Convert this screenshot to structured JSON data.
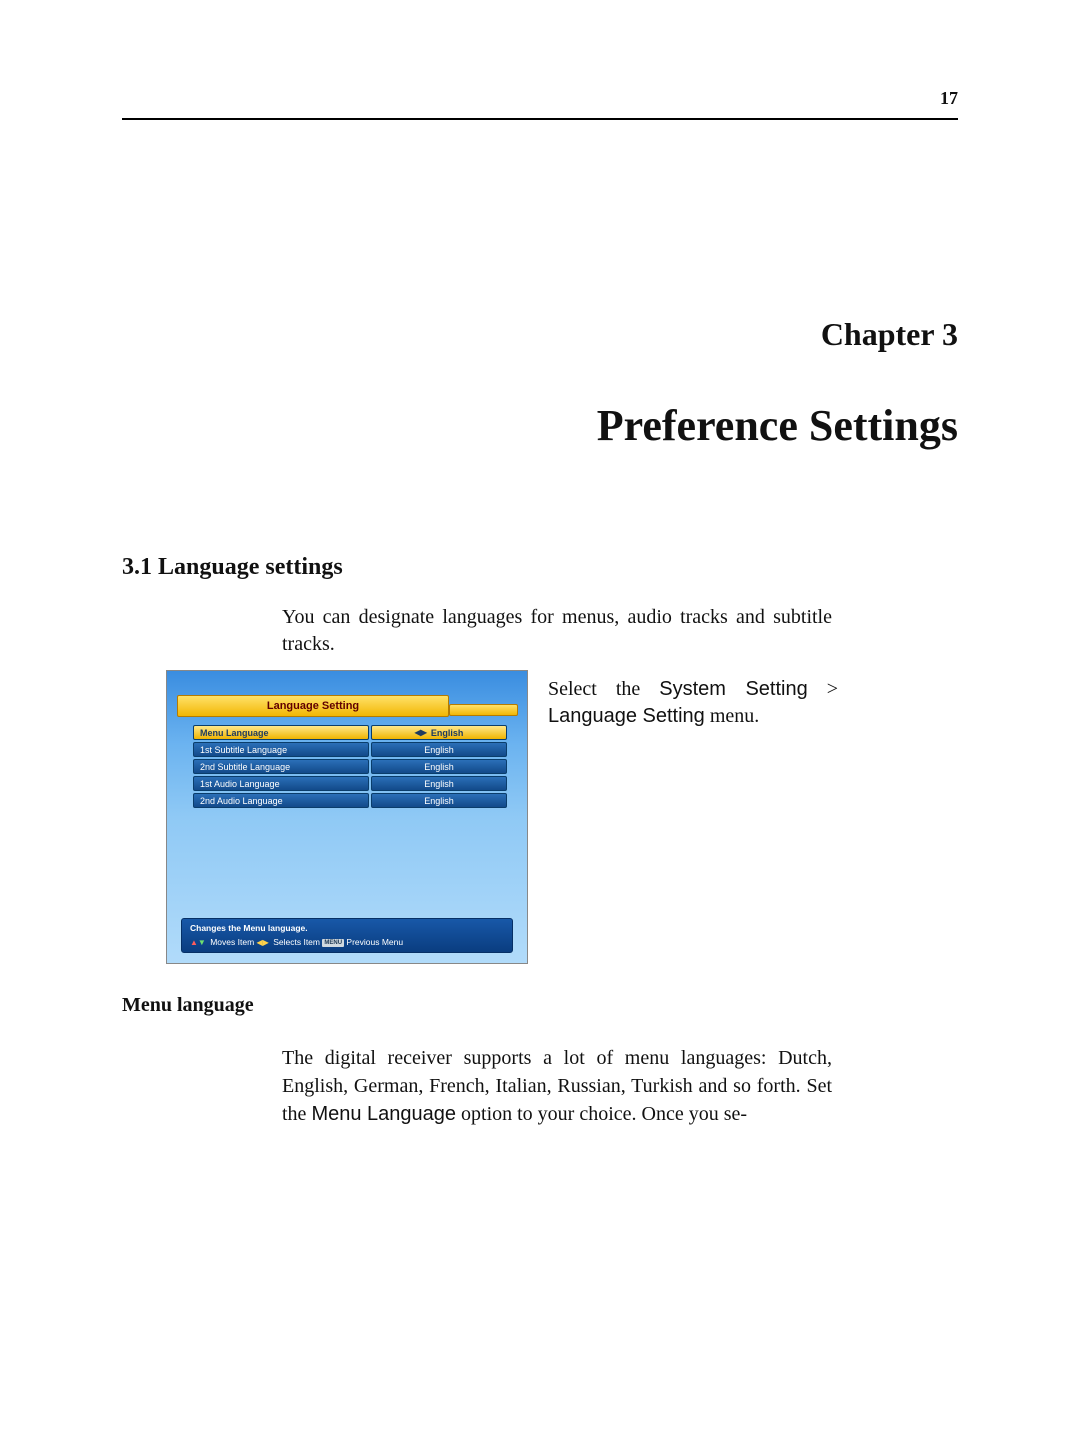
{
  "page_number": "17",
  "chapter_label": "Chapter 3",
  "chapter_title": "Preference Settings",
  "section": {
    "number": "3.1",
    "title": "Language settings",
    "heading_full": "3.1   Language settings"
  },
  "intro_paragraph": "You can designate languages for menus, audio tracks and subtitle tracks.",
  "side_text": {
    "pre": "Select  the ",
    "menu1": "System  Setting",
    "gt": " > ",
    "menu2": "Language Setting",
    "post": " menu."
  },
  "subheading": "Menu language",
  "body2": {
    "t1": "The digital receiver supports a lot of menu languages: Dutch, English, German, French, Italian, Russian, Turkish and so forth. Set the ",
    "opt": "Menu Language",
    "t2": " option to your choice.  Once you se-"
  },
  "device": {
    "title": "Language Setting",
    "rows": [
      {
        "label": "Menu Language",
        "value": "English",
        "selected": true,
        "arrows": true
      },
      {
        "label": "1st Subtitle Language",
        "value": "English",
        "selected": false,
        "arrows": false
      },
      {
        "label": "2nd Subtitle Language",
        "value": "English",
        "selected": false,
        "arrows": false
      },
      {
        "label": "1st Audio Language",
        "value": "English",
        "selected": false,
        "arrows": false
      },
      {
        "label": "2nd Audio Language",
        "value": "English",
        "selected": false,
        "arrows": false
      }
    ],
    "help1": "Changes the Menu language.",
    "help2_moves": "Moves Item",
    "help2_selects": "Selects Item",
    "help2_menu_btn": "MENU",
    "help2_prev": "Previous Menu"
  }
}
